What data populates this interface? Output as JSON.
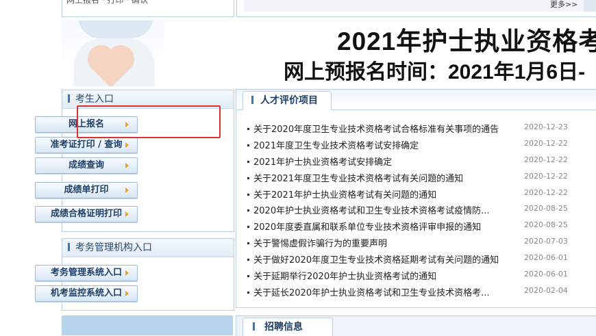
{
  "top": {
    "left_cut_text": "网上报名 · 打印 · 确认",
    "more_link": "更多>>"
  },
  "banner": {
    "title": "2021年护士执业资格考",
    "subtitle": "网上预报名时间：2021年1月6日-"
  },
  "candidate_panel": {
    "title": "考生入口",
    "buttons": [
      "网上报名",
      "准考证打印 / 查询",
      "成绩查询",
      "成绩单打印",
      "成绩合格证明打印"
    ]
  },
  "admin_panel": {
    "title": "考务管理机构入口",
    "buttons": [
      "考务管理系统入口",
      "机考监控系统入口"
    ]
  },
  "news": {
    "tab_label": "人才评价项目",
    "items": [
      {
        "title": "关于2020年度卫生专业技术资格考试合格标准有关事项的通告",
        "date": "2020-12-23"
      },
      {
        "title": "2021年度卫生专业技术资格考试安排确定",
        "date": "2020-12-22"
      },
      {
        "title": "2021年护士执业资格考试安排确定",
        "date": "2020-12-22"
      },
      {
        "title": "关于2021年度卫生专业技术资格考试有关问题的通知",
        "date": "2020-12-22"
      },
      {
        "title": "关于2021年护士执业资格考试有关问题的通知",
        "date": "2020-12-22"
      },
      {
        "title": "2020年护士执业资格考试和卫生专业技术资格考试疫情防...",
        "date": "2020-08-25"
      },
      {
        "title": "2020年度委直属和联系单位专业技术资格评审申报的通知",
        "date": "2020-08-25"
      },
      {
        "title": "关于警惕虚假诈骗行为的重要声明",
        "date": "2020-07-03"
      },
      {
        "title": "关于做好2020年度卫生专业技术资格延期考试有关问题的通知",
        "date": "2020-06-01"
      },
      {
        "title": "关于延期举行2020年护士执业资格考试的通知",
        "date": "2020-06-01"
      },
      {
        "title": "关于延长2020年护士执业资格考试和卫生专业技术资格考...",
        "date": "2020-02-04"
      }
    ]
  },
  "recruit": {
    "tab_label": "招聘信息"
  }
}
